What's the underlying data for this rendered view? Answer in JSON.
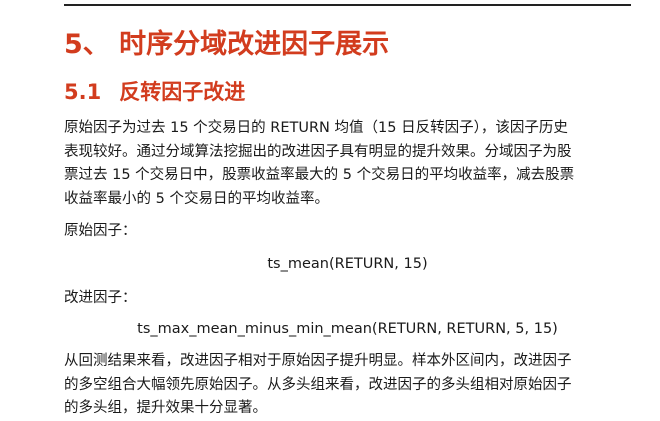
{
  "section": {
    "title": "5、 时序分域改进因子展示"
  },
  "subsection": {
    "number": "5.1",
    "title": "反转因子改进"
  },
  "intro_paragraph": [
    "原始因子为过去 15 个交易日的 RETURN 均值（15 日反转因子），该因子历史",
    "表现较好。通过分域算法挖掘出的改进因子具有明显的提升效果。分域因子为股",
    "票过去 15 个交易日中，股票收益率最大的 5 个交易日的平均收益率，减去股票",
    "收益率最小的 5 个交易日的平均收益率。"
  ],
  "original_factor": {
    "label": "原始因子：",
    "formula": "ts_mean(RETURN, 15)"
  },
  "improved_factor": {
    "label": "改进因子：",
    "formula": "ts_max_mean_minus_min_mean(RETURN, RETURN, 5, 15)"
  },
  "conclusion_paragraph": [
    "从回测结果来看，改进因子相对于原始因子提升明显。样本外区间内，改进因子",
    "的多空组合大幅领先原始因子。从多头组来看，改进因子的多头组相对原始因子",
    "的多头组，提升效果十分显著。"
  ],
  "colors": {
    "heading": "#d23c1e",
    "body_text": "#1a1a1a",
    "rule": "#222222"
  }
}
